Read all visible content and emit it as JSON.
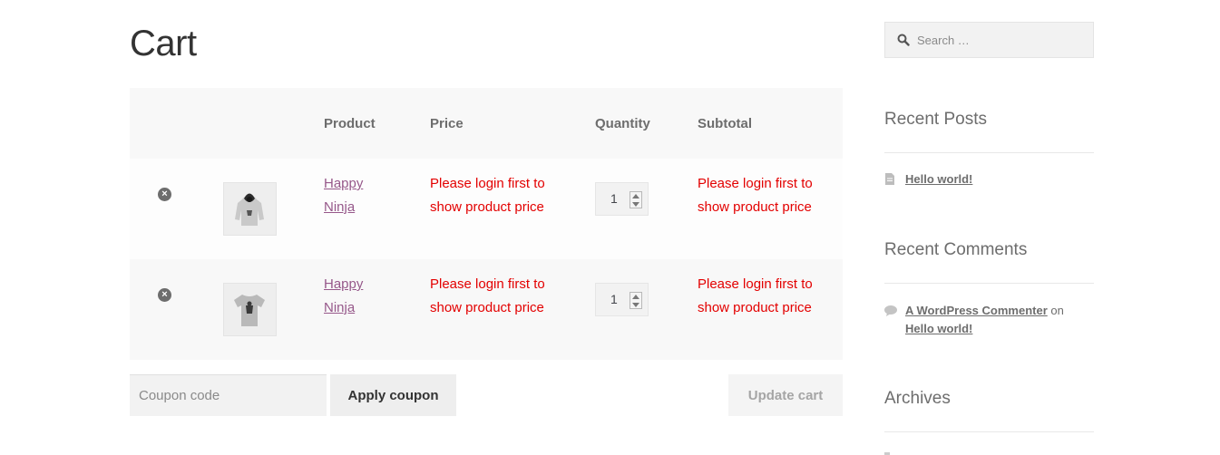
{
  "page": {
    "title": "Cart"
  },
  "cart": {
    "headers": {
      "product": "Product",
      "price": "Price",
      "quantity": "Quantity",
      "subtotal": "Subtotal"
    },
    "items": [
      {
        "name_line1": "Happy",
        "name_line2": "Ninja",
        "price_line1": "Please login first to",
        "price_line2": "show product price",
        "quantity": "1",
        "subtotal_line1": "Please login first to",
        "subtotal_line2": "show product price",
        "thumb_icon": "hoodie-icon"
      },
      {
        "name_line1": "Happy",
        "name_line2": "Ninja",
        "price_line1": "Please login first to",
        "price_line2": "show product price",
        "quantity": "1",
        "subtotal_line1": "Please login first to",
        "subtotal_line2": "show product price",
        "thumb_icon": "tshirt-icon"
      }
    ],
    "coupon_placeholder": "Coupon code",
    "apply_coupon_label": "Apply coupon",
    "update_cart_label": "Update cart",
    "remove_icon": "remove-icon"
  },
  "sidebar": {
    "search_placeholder": "Search …",
    "recent_posts_title": "Recent Posts",
    "recent_posts": [
      {
        "label": "Hello world!"
      }
    ],
    "recent_comments_title": "Recent Comments",
    "recent_comments": [
      {
        "author": "A WordPress Commenter",
        "connector": "on",
        "post": "Hello world!"
      }
    ],
    "archives_title": "Archives"
  },
  "colors": {
    "accent_link": "#96588a",
    "price_notice": "#e30000",
    "text": "#43454b"
  }
}
